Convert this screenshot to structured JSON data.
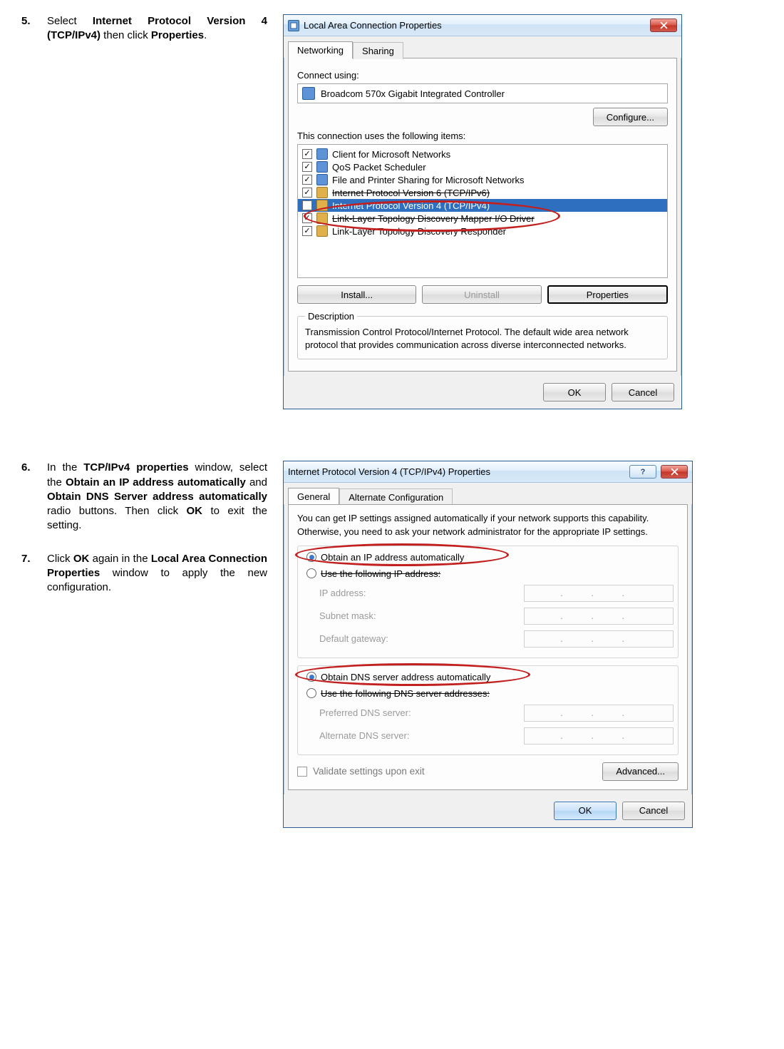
{
  "steps": {
    "s5": {
      "num": "5.",
      "text_a": "Select ",
      "b1": "Internet Protocol Version 4 (TCP/IPv4)",
      "text_b": " then click ",
      "b2": "Properties",
      "text_c": "."
    },
    "s6": {
      "num": "6.",
      "text_a": "In the ",
      "b1": "TCP/IPv4 properties",
      "text_b": " window, select the ",
      "b2": "Obtain an IP address automatically",
      "text_c": " and ",
      "b3": "Obtain DNS Server address automatically",
      "text_d": " radio buttons. Then click ",
      "b4": "OK",
      "text_e": " to exit the setting."
    },
    "s7": {
      "num": "7.",
      "text_a": "Click ",
      "b1": "OK",
      "text_b": " again in the ",
      "b2": "Local Area Connection Properties",
      "text_c": " window to apply the new configuration."
    }
  },
  "win1": {
    "title": "Local Area Connection Properties",
    "tabs": [
      "Networking",
      "Sharing"
    ],
    "connect_label": "Connect using:",
    "adapter": "Broadcom 570x Gigabit Integrated Controller",
    "configure": "Configure...",
    "items_label": "This connection uses the following items:",
    "items": [
      "Client for Microsoft Networks",
      "QoS Packet Scheduler",
      "File and Printer Sharing for Microsoft Networks",
      "Internet Protocol Version 6 (TCP/IPv6)",
      "Internet Protocol Version 4 (TCP/IPv4)",
      "Link-Layer Topology Discovery Mapper I/O Driver",
      "Link-Layer Topology Discovery Responder"
    ],
    "install": "Install...",
    "uninstall": "Uninstall",
    "properties": "Properties",
    "desc_label": "Description",
    "desc": "Transmission Control Protocol/Internet Protocol. The default wide area network protocol that provides communication across diverse interconnected networks.",
    "ok": "OK",
    "cancel": "Cancel"
  },
  "win2": {
    "title": "Internet Protocol Version 4 (TCP/IPv4) Properties",
    "tabs": [
      "General",
      "Alternate Configuration"
    ],
    "note": "You can get IP settings assigned automatically if your network supports this capability. Otherwise, you need to ask your network administrator for the appropriate IP settings.",
    "r1": "Obtain an IP address automatically",
    "r2": "Use the following IP address:",
    "ip": "IP address:",
    "mask": "Subnet mask:",
    "gw": "Default gateway:",
    "r3": "Obtain DNS server address automatically",
    "r4": "Use the following DNS server addresses:",
    "pdns": "Preferred DNS server:",
    "adns": "Alternate DNS server:",
    "validate": "Validate settings upon exit",
    "advanced": "Advanced...",
    "ok": "OK",
    "cancel": "Cancel",
    "help_glyph": "?"
  }
}
